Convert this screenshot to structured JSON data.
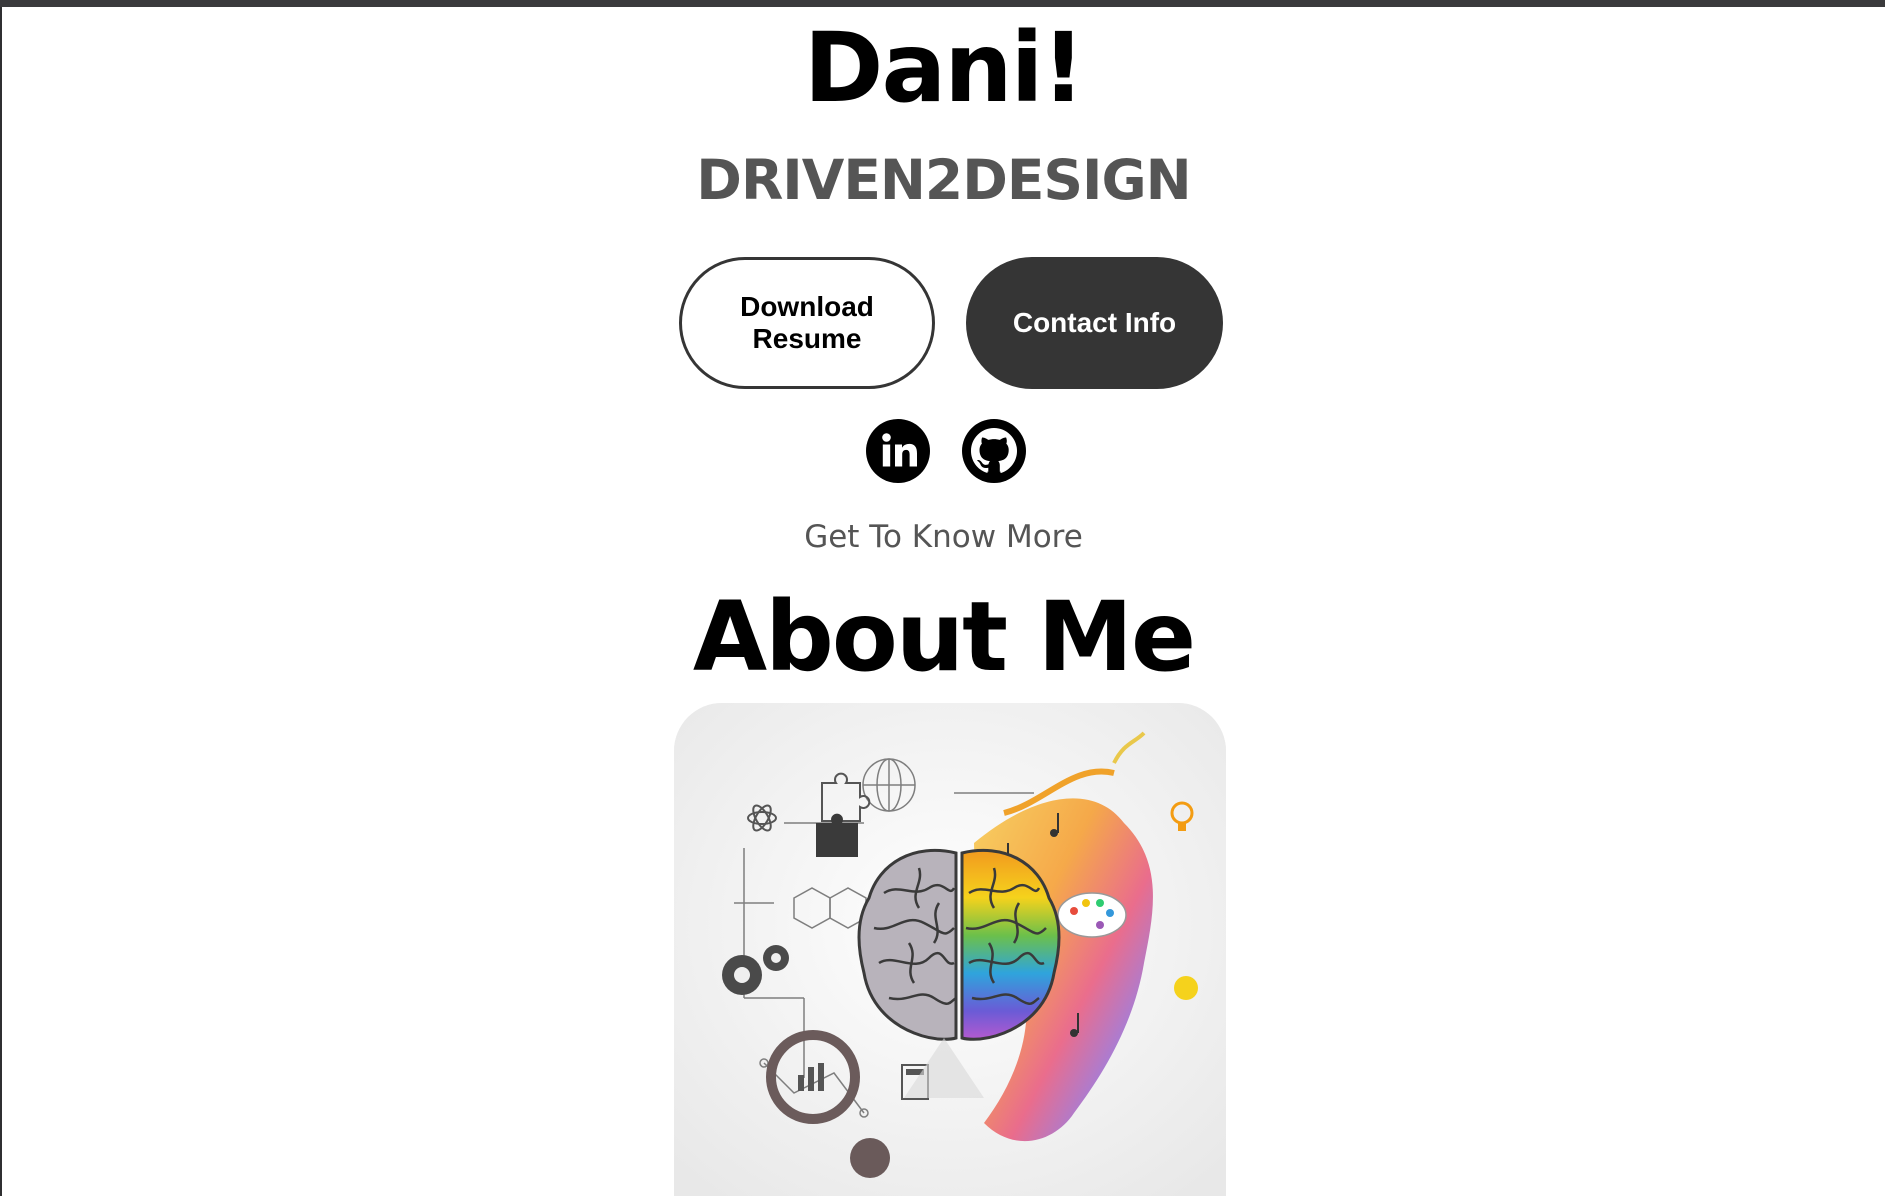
{
  "hero": {
    "name": "Dani!",
    "subtitle": "DRIVEN2DESIGN"
  },
  "buttons": {
    "download_resume": "Download Resume",
    "contact_info": "Contact Info"
  },
  "social": {
    "linkedin_icon": "linkedin-icon",
    "github_icon": "github-icon"
  },
  "about": {
    "eyebrow": "Get To Know More",
    "title": "About Me",
    "image": "brain-left-right-illustration"
  },
  "colors": {
    "dark_button": "#353535",
    "subtitle_gray": "#555555"
  }
}
